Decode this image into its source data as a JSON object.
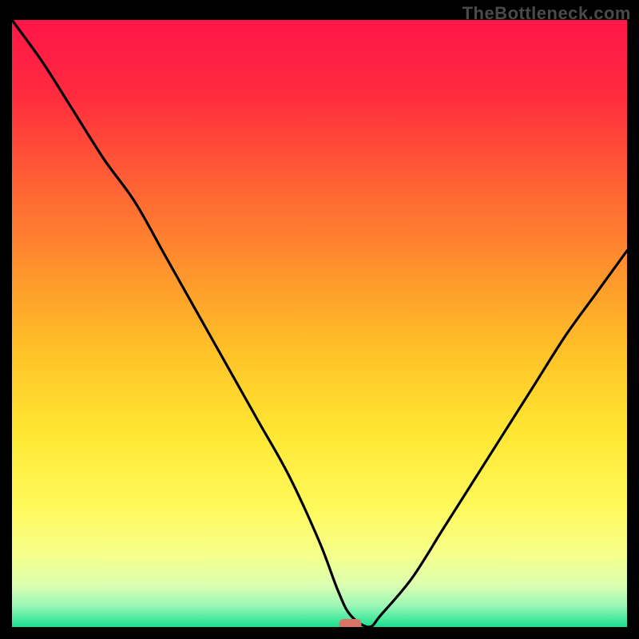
{
  "watermark": "TheBottleneck.com",
  "chart_data": {
    "type": "line",
    "title": "",
    "xlabel": "",
    "ylabel": "",
    "xlim": [
      0,
      100
    ],
    "ylim": [
      0,
      100
    ],
    "x": [
      0,
      5,
      10,
      15,
      20,
      25,
      30,
      35,
      40,
      45,
      50,
      53,
      55,
      58,
      60,
      65,
      70,
      75,
      80,
      85,
      90,
      95,
      100
    ],
    "values": [
      100,
      93,
      85,
      77,
      70,
      61,
      52,
      43,
      34,
      25,
      14,
      6,
      2,
      0,
      2,
      8,
      16,
      24,
      32,
      40,
      48,
      55,
      62
    ],
    "marker": {
      "x": 55,
      "y": 0,
      "color": "#d9736a"
    },
    "gradient_stops": [
      {
        "offset": 0,
        "color": "#ff1648"
      },
      {
        "offset": 0.12,
        "color": "#ff2a3f"
      },
      {
        "offset": 0.25,
        "color": "#ff5a36"
      },
      {
        "offset": 0.4,
        "color": "#ff8f2d"
      },
      {
        "offset": 0.55,
        "color": "#ffc327"
      },
      {
        "offset": 0.68,
        "color": "#ffe733"
      },
      {
        "offset": 0.8,
        "color": "#fff95a"
      },
      {
        "offset": 0.88,
        "color": "#f6ff8a"
      },
      {
        "offset": 0.93,
        "color": "#dcffb0"
      },
      {
        "offset": 0.965,
        "color": "#9bf7b8"
      },
      {
        "offset": 1.0,
        "color": "#18e08f"
      }
    ]
  }
}
